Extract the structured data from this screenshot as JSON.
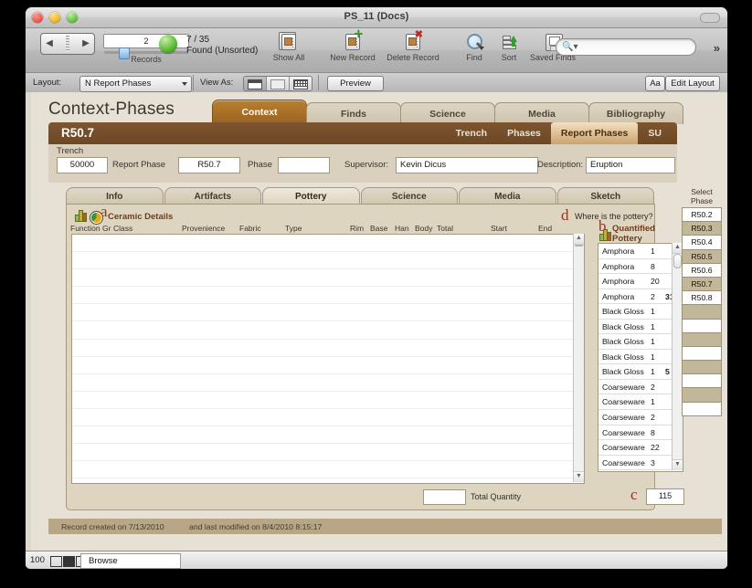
{
  "window": {
    "title": "PS_11 (Docs)"
  },
  "toolbar": {
    "record_number": "2",
    "found_count": "7 / 35",
    "found_status": "Found (Unsorted)",
    "records_caption": "Records",
    "show_all": "Show All",
    "new_record": "New Record",
    "delete_record": "Delete Record",
    "find": "Find",
    "sort": "Sort",
    "saved_finds": "Saved Finds",
    "search_placeholder": ""
  },
  "layoutbar": {
    "layout_label": "Layout:",
    "layout_value": "N Report Phases",
    "view_as_label": "View As:",
    "preview": "Preview",
    "text_format": "Aa",
    "edit_layout": "Edit Layout"
  },
  "page": {
    "title": "Context-Phases",
    "outer_tabs": [
      {
        "label": "Context",
        "active": true
      },
      {
        "label": "Finds",
        "active": false
      },
      {
        "label": "Science",
        "active": false
      },
      {
        "label": "Media",
        "active": false
      },
      {
        "label": "Bibliography",
        "active": false
      }
    ],
    "record_id": "R50.7",
    "sub_tabs": [
      {
        "label": "Trench",
        "active": false
      },
      {
        "label": "Phases",
        "active": false
      },
      {
        "label": "Report Phases",
        "active": true
      },
      {
        "label": "SU",
        "active": false
      }
    ],
    "fields": {
      "trench_label": "Trench",
      "trench_value": "50000",
      "report_phase_label": "Report Phase",
      "report_phase_value": "R50.7",
      "phase_label": "Phase",
      "phase_value": "",
      "supervisor_label": "Supervisor:",
      "supervisor_value": "Kevin Dicus",
      "description_label": "Description:",
      "description_value": "Eruption"
    },
    "inner_tabs": [
      {
        "label": "Info",
        "active": false
      },
      {
        "label": "Artifacts",
        "active": false
      },
      {
        "label": "Pottery",
        "active": true
      },
      {
        "label": "Science",
        "active": false
      },
      {
        "label": "Media",
        "active": false
      },
      {
        "label": "Sketch",
        "active": false
      }
    ],
    "annotations": {
      "a": "a",
      "b": "b",
      "c": "c",
      "d": "d"
    },
    "ceramic_details": {
      "heading": "Ceramic Details",
      "columns": [
        "Function Gr",
        "Class",
        "Provenience",
        "Fabric",
        "Type",
        "Rim",
        "Base",
        "Han",
        "Body",
        "Total",
        "Start",
        "End"
      ],
      "rows": []
    },
    "where_is_pottery": "Where is the pottery?",
    "quantified_pottery": {
      "heading": "Quantified Pottery",
      "rows": [
        {
          "name": "Amphora",
          "count": "1",
          "subtotal": ""
        },
        {
          "name": "Amphora",
          "count": "8",
          "subtotal": ""
        },
        {
          "name": "Amphora",
          "count": "20",
          "subtotal": ""
        },
        {
          "name": "Amphora",
          "count": "2",
          "subtotal": "31"
        },
        {
          "name": "Black Gloss",
          "count": "1",
          "subtotal": ""
        },
        {
          "name": "Black Gloss",
          "count": "1",
          "subtotal": ""
        },
        {
          "name": "Black Gloss",
          "count": "1",
          "subtotal": ""
        },
        {
          "name": "Black Gloss",
          "count": "1",
          "subtotal": ""
        },
        {
          "name": "Black Gloss",
          "count": "1",
          "subtotal": "5"
        },
        {
          "name": "Coarseware",
          "count": "2",
          "subtotal": ""
        },
        {
          "name": "Coarseware",
          "count": "1",
          "subtotal": ""
        },
        {
          "name": "Coarseware",
          "count": "2",
          "subtotal": ""
        },
        {
          "name": "Coarseware",
          "count": "8",
          "subtotal": ""
        },
        {
          "name": "Coarseware",
          "count": "22",
          "subtotal": ""
        },
        {
          "name": "Coarseware",
          "count": "3",
          "subtotal": ""
        }
      ]
    },
    "total_quantity_label": "Total Quantity",
    "total_quantity_value": "",
    "grand_total_value": "115",
    "select_phase": {
      "header_line1": "Select",
      "header_line2": "Phase",
      "rows": [
        "R50.2",
        "R50.3",
        "R50.4",
        "R50.5",
        "R50.6",
        "R50.7",
        "R50.8",
        "",
        "",
        "",
        "",
        "",
        "",
        "",
        ""
      ]
    },
    "footer": {
      "created": "Record created on 7/13/2010",
      "modified": "and last modified on 8/4/2010 8:15:17"
    }
  },
  "statusbar": {
    "zoom": "100",
    "mode": "Browse"
  },
  "colors": {
    "accent_brown": "#9a6321",
    "band_brown": "#6d4824",
    "panel_tan": "#ded5c1",
    "page_tan": "#e7e1d5",
    "annotation_red": "#9b2f22",
    "heading_brown": "#6e3b1c"
  }
}
